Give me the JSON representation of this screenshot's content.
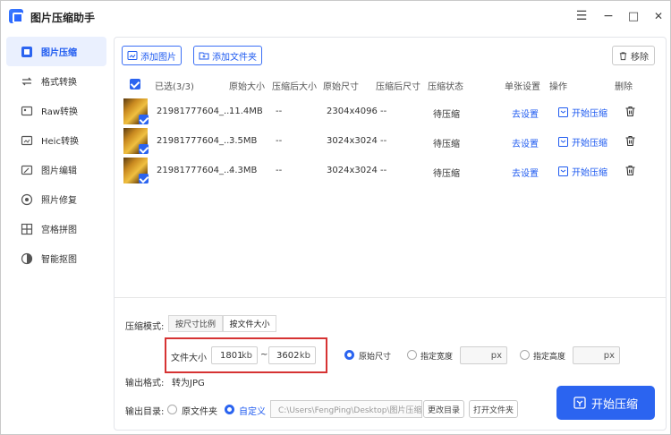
{
  "app": {
    "title": "图片压缩助手",
    "minimize": "−",
    "maximize": "□",
    "close": "✕",
    "menu": "☰"
  },
  "sidebar": {
    "items": [
      {
        "label": "图片压缩",
        "icon": "compress-icon"
      },
      {
        "label": "格式转换",
        "icon": "format-icon"
      },
      {
        "label": "Raw转换",
        "icon": "raw-icon"
      },
      {
        "label": "Heic转换",
        "icon": "heic-icon"
      },
      {
        "label": "图片编辑",
        "icon": "edit-icon"
      },
      {
        "label": "照片修复",
        "icon": "repair-icon"
      },
      {
        "label": "宫格拼图",
        "icon": "grid-icon"
      },
      {
        "label": "智能抠图",
        "icon": "cutout-icon"
      }
    ]
  },
  "toolbar": {
    "add_image": "添加图片",
    "add_folder": "添加文件夹",
    "remove": "移除"
  },
  "table": {
    "headers": {
      "selected": "已选(3/3)",
      "orig_size": "原始大小",
      "comp_size": "压缩后大小",
      "orig_dim": "原始尺寸",
      "comp_dim": "压缩后尺寸",
      "status": "压缩状态",
      "single": "单张设置",
      "action": "操作",
      "delete": "删除"
    },
    "rows": [
      {
        "name": "21981777604_...",
        "orig_size": "11.4MB",
        "comp_size": "--",
        "orig_dim": "2304x4096",
        "comp_dim": "--",
        "status": "待压缩",
        "settings": "去设置",
        "start": "开始压缩"
      },
      {
        "name": "21981777604_...",
        "orig_size": "3.5MB",
        "comp_size": "--",
        "orig_dim": "3024x3024",
        "comp_dim": "--",
        "status": "待压缩",
        "settings": "去设置",
        "start": "开始压缩"
      },
      {
        "name": "21981777604_...",
        "orig_size": "4.3MB",
        "comp_size": "--",
        "orig_dim": "3024x3024",
        "comp_dim": "--",
        "status": "待压缩",
        "settings": "去设置",
        "start": "开始压缩"
      }
    ]
  },
  "settings": {
    "mode_label": "压缩模式:",
    "tab_ratio": "按尺寸比例",
    "tab_filesize": "按文件大小",
    "filesize_label": "文件大小",
    "min_value": "1801",
    "max_value": "3602",
    "unit_kb": "kb",
    "tilde": "~",
    "orig_dim_option": "原始尺寸",
    "width_option": "指定宽度",
    "height_option": "指定高度",
    "unit_px": "px",
    "output_format_label": "输出格式:",
    "output_format_value": "转为JPG",
    "output_dir_label": "输出目录:",
    "dir_original": "原文件夹",
    "dir_custom": "自定义",
    "dir_path": "C:\\Users\\FengPing\\Desktop\\图片压缩",
    "change_dir": "更改目录",
    "open_folder": "打开文件夹",
    "start_button": "开始压缩"
  },
  "colors": {
    "accent": "#2b64f0",
    "highlight_box": "#d63333"
  }
}
